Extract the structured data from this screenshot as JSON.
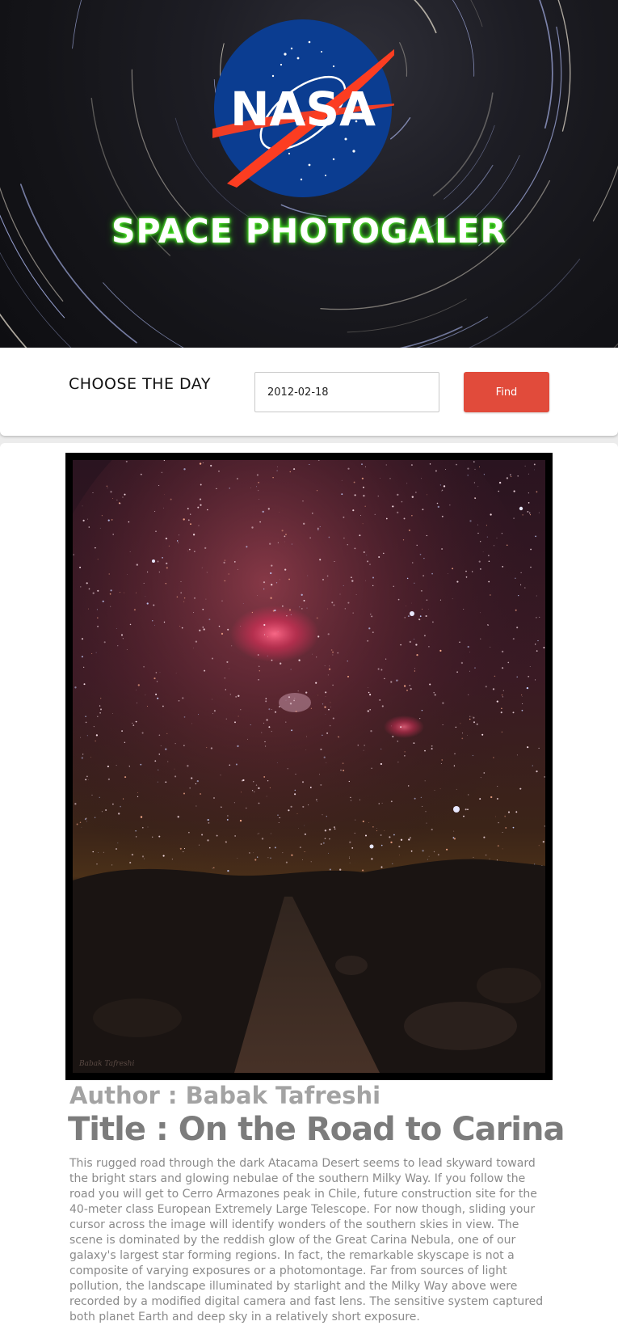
{
  "header": {
    "logo_text": "NASA",
    "site_title": "SPACE PHOTOGALER"
  },
  "search": {
    "label": "CHOOSE THE DAY",
    "date_value": "2012-02-18",
    "button_label": "Find"
  },
  "photo": {
    "credit": "Babak Tafreshi",
    "author": "Author : Babak Tafreshi",
    "title": "Title : On the Road to Carina",
    "description": "This rugged road through the dark Atacama Desert seems to lead skyward toward the bright stars and glowing nebulae of the southern Milky Way. If you follow the road you will get to Cerro Armazones peak in Chile, future construction site for the 40-meter class European Extremely Large Telescope. For now though, sliding your cursor across the image will identify wonders of the southern skies in view. The scene is dominated by the reddish glow of the Great Carina Nebula, one of our galaxy's largest star forming regions. In fact, the remarkable skyscape is not a composite of varying exposures or a photomontage. Far from sources of light pollution, the landscape illuminated by starlight and the Milky Way above were recorded by a modified digital camera and fast lens. The sensitive system captured both planet Earth and deep sky in a relatively short exposure."
  },
  "colors": {
    "accent": "#e14b3b",
    "title_glow": "#3cd81e",
    "nasa_blue": "#0b3d91",
    "nasa_red": "#fc3d21"
  },
  "icons": {
    "logo": "nasa-meatball-logo"
  }
}
